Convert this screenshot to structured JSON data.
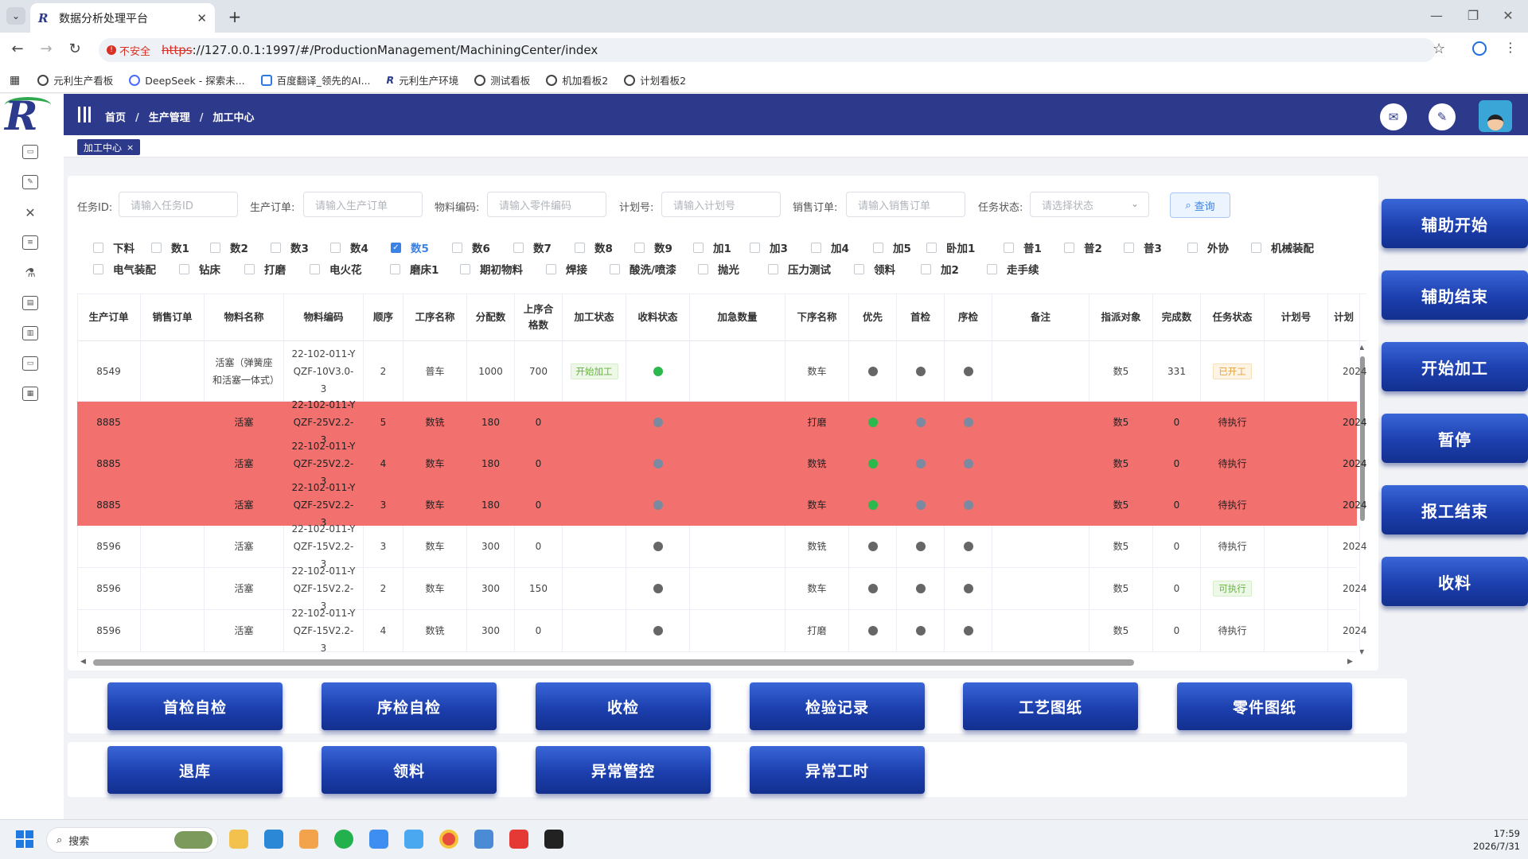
{
  "browser": {
    "tab_title": "数据分析处理平台",
    "url_scheme": "https",
    "url_rest": "://127.0.0.1:1997/#/ProductionManagement/MachiningCenter/index",
    "insecure_label": "不安全",
    "bookmarks": [
      "元利生产看板",
      "DeepSeek - 探索未...",
      "百度翻译_领先的AI...",
      "元利生产环境",
      "测试看板",
      "机加看板2",
      "计划看板2"
    ]
  },
  "header": {
    "breadcrumbs": [
      "首页",
      "生产管理",
      "加工中心"
    ],
    "active_tag": "加工中心"
  },
  "filters": {
    "task_id": {
      "label": "任务ID:",
      "placeholder": "请输入任务ID"
    },
    "prod_order": {
      "label": "生产订单:",
      "placeholder": "请输入生产订单"
    },
    "material_code": {
      "label": "物料编码:",
      "placeholder": "请输入零件编码"
    },
    "plan_no": {
      "label": "计划号:",
      "placeholder": "请输入计划号"
    },
    "sales_order": {
      "label": "销售订单:",
      "placeholder": "请输入销售订单"
    },
    "task_status": {
      "label": "任务状态:",
      "placeholder": "请选择状态"
    },
    "query_label": "查询"
  },
  "checks_row1": [
    "下料",
    "数1",
    "数2",
    "数3",
    "数4",
    "数5",
    "数6",
    "数7",
    "数8",
    "数9",
    "加1",
    "加3",
    "加4",
    "加5",
    "卧加1",
    "普1",
    "普2",
    "普3",
    "外协",
    "机械装配"
  ],
  "checks_row2": [
    "电气装配",
    "钻床",
    "打磨",
    "电火花",
    "磨床1",
    "期初物料",
    "焊接",
    "酸洗/喷漆",
    "抛光",
    "压力测试",
    "领料",
    "加2",
    "走手续"
  ],
  "checked": "数5",
  "table": {
    "headers": [
      "生产订单",
      "销售订单",
      "物料名称",
      "物料编码",
      "顺序",
      "工序名称",
      "分配数",
      "上序合格数",
      "加工状态",
      "收料状态",
      "加急数量",
      "下序名称",
      "优先",
      "首检",
      "序检",
      "备注",
      "指派对象",
      "完成数",
      "任务状态",
      "计划号",
      "计划"
    ],
    "rows": [
      {
        "order": "8549",
        "sales": "",
        "name": "活塞（弹簧座和活塞一体式）",
        "code": "22-102-011-Y QZF-10V3.0-3",
        "seq": "2",
        "proc": "普车",
        "alloc": "1000",
        "prev": "700",
        "mstat": "开始加工",
        "recv": "green",
        "urgent": "",
        "next": "数车",
        "pri": "gray",
        "first": "gray",
        "seqchk": "gray",
        "note": "",
        "assign": "数5",
        "done": "331",
        "tstat": "已开工",
        "plan": "",
        "pdate": "2024",
        "red": false
      },
      {
        "order": "8885",
        "sales": "",
        "name": "活塞",
        "code": "22-102-011-Y QZF-25V2.2-3",
        "seq": "5",
        "proc": "数铣",
        "alloc": "180",
        "prev": "0",
        "mstat": "",
        "recv": "gray",
        "urgent": "",
        "next": "打磨",
        "pri": "green",
        "first": "gray",
        "seqchk": "gray",
        "note": "",
        "assign": "数5",
        "done": "0",
        "tstat": "待执行",
        "plan": "",
        "pdate": "2024",
        "red": true
      },
      {
        "order": "8885",
        "sales": "",
        "name": "活塞",
        "code": "22-102-011-Y QZF-25V2.2-3",
        "seq": "4",
        "proc": "数车",
        "alloc": "180",
        "prev": "0",
        "mstat": "",
        "recv": "gray",
        "urgent": "",
        "next": "数铣",
        "pri": "green",
        "first": "gray",
        "seqchk": "gray",
        "note": "",
        "assign": "数5",
        "done": "0",
        "tstat": "待执行",
        "plan": "",
        "pdate": "2024",
        "red": true
      },
      {
        "order": "8885",
        "sales": "",
        "name": "活塞",
        "code": "22-102-011-Y QZF-25V2.2-3",
        "seq": "3",
        "proc": "数车",
        "alloc": "180",
        "prev": "0",
        "mstat": "",
        "recv": "gray",
        "urgent": "",
        "next": "数车",
        "pri": "green",
        "first": "gray",
        "seqchk": "gray",
        "note": "",
        "assign": "数5",
        "done": "0",
        "tstat": "待执行",
        "plan": "",
        "pdate": "2024",
        "red": true
      },
      {
        "order": "8596",
        "sales": "",
        "name": "活塞",
        "code": "22-102-011-Y QZF-15V2.2-3",
        "seq": "3",
        "proc": "数车",
        "alloc": "300",
        "prev": "0",
        "mstat": "",
        "recv": "gray",
        "urgent": "",
        "next": "数铣",
        "pri": "gray",
        "first": "gray",
        "seqchk": "gray",
        "note": "",
        "assign": "数5",
        "done": "0",
        "tstat": "待执行",
        "plan": "",
        "pdate": "2024",
        "red": false
      },
      {
        "order": "8596",
        "sales": "",
        "name": "活塞",
        "code": "22-102-011-Y QZF-15V2.2-3",
        "seq": "2",
        "proc": "数车",
        "alloc": "300",
        "prev": "150",
        "mstat": "",
        "recv": "gray",
        "urgent": "",
        "next": "数车",
        "pri": "gray",
        "first": "gray",
        "seqchk": "gray",
        "note": "",
        "assign": "数5",
        "done": "0",
        "tstat": "可执行",
        "plan": "",
        "pdate": "2024",
        "red": false
      },
      {
        "order": "8596",
        "sales": "",
        "name": "活塞",
        "code": "22-102-011-Y QZF-15V2.2-3",
        "seq": "4",
        "proc": "数铣",
        "alloc": "300",
        "prev": "0",
        "mstat": "",
        "recv": "gray",
        "urgent": "",
        "next": "打磨",
        "pri": "gray",
        "first": "gray",
        "seqchk": "gray",
        "note": "",
        "assign": "数5",
        "done": "0",
        "tstat": "待执行",
        "plan": "",
        "pdate": "2024",
        "red": false
      }
    ]
  },
  "right_buttons": [
    "辅助开始",
    "辅助结束",
    "开始加工",
    "暂停",
    "报工结束",
    "收料"
  ],
  "bottom_row1": [
    "首检自检",
    "序检自检",
    "收检",
    "检验记录",
    "工艺图纸",
    "零件图纸"
  ],
  "bottom_row2": [
    "退库",
    "领料",
    "异常管控",
    "异常工时"
  ],
  "taskbar": {
    "search_label": "搜索",
    "time": "17:59",
    "date": "2026/7/31"
  }
}
